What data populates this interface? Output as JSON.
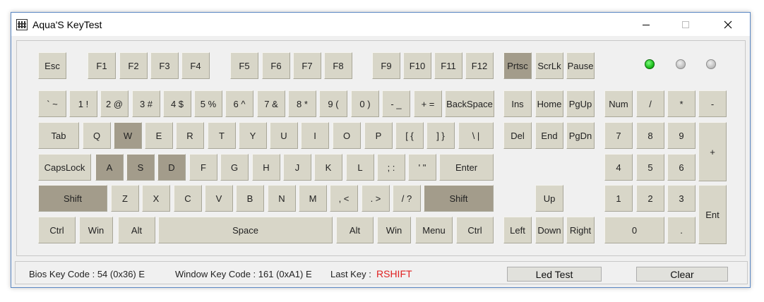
{
  "window": {
    "title": "Aqua'S KeyTest"
  },
  "keys": {
    "esc": "Esc",
    "f1": "F1",
    "f2": "F2",
    "f3": "F3",
    "f4": "F4",
    "f5": "F5",
    "f6": "F6",
    "f7": "F7",
    "f8": "F8",
    "f9": "F9",
    "f10": "F10",
    "f11": "F11",
    "f12": "F12",
    "prtsc": "Prtsc",
    "scrlk": "ScrLk",
    "pause": "Pause",
    "backtick": "` ~",
    "n1": "1 !",
    "n2": "2 @",
    "n3": "3 #",
    "n4": "4 $",
    "n5": "5 %",
    "n6": "6 ^",
    "n7": "7 &",
    "n8": "8 *",
    "n9": "9 (",
    "n0": "0 )",
    "minus": "- _",
    "equal": "+ =",
    "backspace": "BackSpace",
    "ins": "Ins",
    "home": "Home",
    "pgup": "PgUp",
    "num": "Num",
    "numslash": "/",
    "numstar": "*",
    "numminus": "-",
    "tab": "Tab",
    "q": "Q",
    "w": "W",
    "e": "E",
    "r": "R",
    "t": "T",
    "y": "Y",
    "u": "U",
    "i": "I",
    "o": "O",
    "p": "P",
    "lbracket": "[ {",
    "rbracket": "] }",
    "backslash": "\\ |",
    "del": "Del",
    "end": "End",
    "pgdn": "PgDn",
    "num7": "7",
    "num8": "8",
    "num9": "9",
    "numplus": "+",
    "capslock": "CapsLock",
    "a": "A",
    "s": "S",
    "d": "D",
    "f": "F",
    "g": "G",
    "h": "H",
    "j": "J",
    "k": "K",
    "l": "L",
    "semicolon": "; :",
    "quote": "' \"",
    "enter": "Enter",
    "num4": "4",
    "num5": "5",
    "num6": "6",
    "lshift": "Shift",
    "z": "Z",
    "x": "X",
    "c": "C",
    "v": "V",
    "b": "B",
    "n": "N",
    "m": "M",
    "comma": ", <",
    "period": ". >",
    "slash": "/ ?",
    "rshift": "Shift",
    "up": "Up",
    "num1": "1",
    "num2": "2",
    "num3": "3",
    "numenter": "Ent",
    "lctrl": "Ctrl",
    "lwin": "Win",
    "lalt": "Alt",
    "space": "Space",
    "ralt": "Alt",
    "rwin": "Win",
    "menu": "Menu",
    "rctrl": "Ctrl",
    "left": "Left",
    "down": "Down",
    "right": "Right",
    "num0": "0",
    "numdot": "."
  },
  "pressed_keys": [
    "w",
    "a",
    "s",
    "d",
    "lshift",
    "rshift",
    "prtsc"
  ],
  "leds": [
    {
      "name": "num-lock",
      "on": true
    },
    {
      "name": "caps-lock",
      "on": false
    },
    {
      "name": "scroll-lock",
      "on": false
    }
  ],
  "status": {
    "bios_label": "Bios Key Code : 54 (0x36) E",
    "window_label": "Window Key Code : 161 (0xA1) E",
    "last_key_label": "Last Key :",
    "last_key_value": "RSHIFT",
    "led_test_label": "Led Test",
    "clear_label": "Clear"
  },
  "colors": {
    "key_face": "#d8d6c8",
    "key_pressed": "#a39c8b",
    "last_key": "#e02020",
    "led_on": "#1fbf1f"
  }
}
